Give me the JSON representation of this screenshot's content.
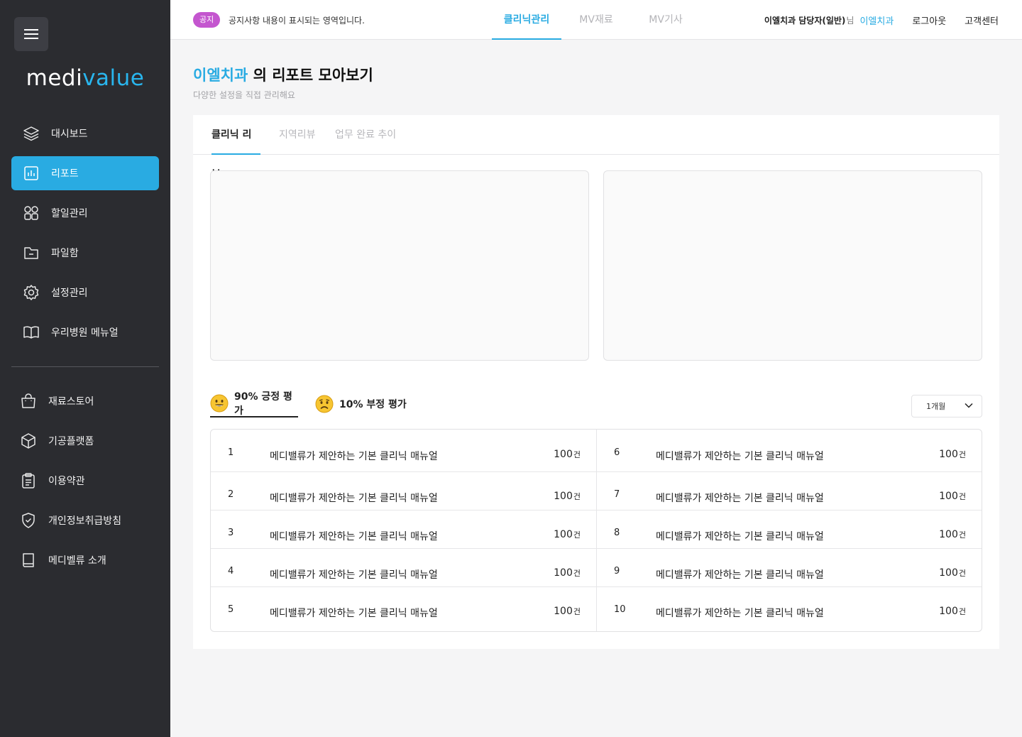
{
  "brand": {
    "logo_a": "medi",
    "logo_b": "value",
    "accent": "#29abe2"
  },
  "sidebar": {
    "items": [
      {
        "label": "대시보드",
        "icon": "layers-icon"
      },
      {
        "label": "리포트",
        "icon": "chart-icon"
      },
      {
        "label": "할일관리",
        "icon": "grid-icon"
      },
      {
        "label": "파일함",
        "icon": "folder-icon"
      },
      {
        "label": "설정관리",
        "icon": "gear-icon"
      },
      {
        "label": "우리병원 메뉴얼",
        "icon": "book-open-icon"
      }
    ],
    "items2": [
      {
        "label": "재료스토어",
        "icon": "shopping-bag-icon"
      },
      {
        "label": "기공플랫폼",
        "icon": "cube-icon"
      },
      {
        "label": "이용약관",
        "icon": "clipboard-icon"
      },
      {
        "label": "개인정보취급방침",
        "icon": "shield-icon"
      },
      {
        "label": "메디벨류 소개",
        "icon": "book-icon"
      }
    ]
  },
  "header": {
    "notice_badge": "공지",
    "notice_text": "공지사항 내용이 표시되는 영역입니다.",
    "tabs": [
      "클리닉관리",
      "MV재료",
      "MV기사"
    ],
    "user_name": "이엘치과 담당자(일반)",
    "user_suffix": "님",
    "clinic": "이엘치과",
    "logout": "로그아웃",
    "support": "고객센터"
  },
  "page": {
    "title_hl": "이엘치과",
    "title_rest": " 의 리포트 모아보기",
    "subtitle": "다양한 설정을 직접 관리해요"
  },
  "tabs": [
    "클리닉 리뷰",
    "지역리뷰",
    "업무 완료 추이"
  ],
  "ratings": {
    "positive": "90% 긍정 평가",
    "negative": "10% 부정 평가",
    "period": "1개월"
  },
  "list": {
    "unit": "건",
    "rows": [
      {
        "num": "1",
        "title": "메디밸류가 제안하는 기본 클리닉 매뉴얼",
        "count": "100"
      },
      {
        "num": "2",
        "title": "메디밸류가 제안하는 기본 클리닉 매뉴얼",
        "count": "100"
      },
      {
        "num": "3",
        "title": "메디밸류가 제안하는 기본 클리닉 매뉴얼",
        "count": "100"
      },
      {
        "num": "4",
        "title": "메디밸류가 제안하는 기본 클리닉 매뉴얼",
        "count": "100"
      },
      {
        "num": "5",
        "title": "메디밸류가 제안하는 기본 클리닉 매뉴얼",
        "count": "100"
      },
      {
        "num": "6",
        "title": "메디밸류가 제안하는 기본 클리닉 매뉴얼",
        "count": "100"
      },
      {
        "num": "7",
        "title": "메디밸류가 제안하는 기본 클리닉 매뉴얼",
        "count": "100"
      },
      {
        "num": "8",
        "title": "메디밸류가 제안하는 기본 클리닉 매뉴얼",
        "count": "100"
      },
      {
        "num": "9",
        "title": "메디밸류가 제안하는 기본 클리닉 매뉴얼",
        "count": "100"
      },
      {
        "num": "10",
        "title": "메디밸류가 제안하는 기본 클리닉 매뉴얼",
        "count": "100"
      }
    ]
  }
}
